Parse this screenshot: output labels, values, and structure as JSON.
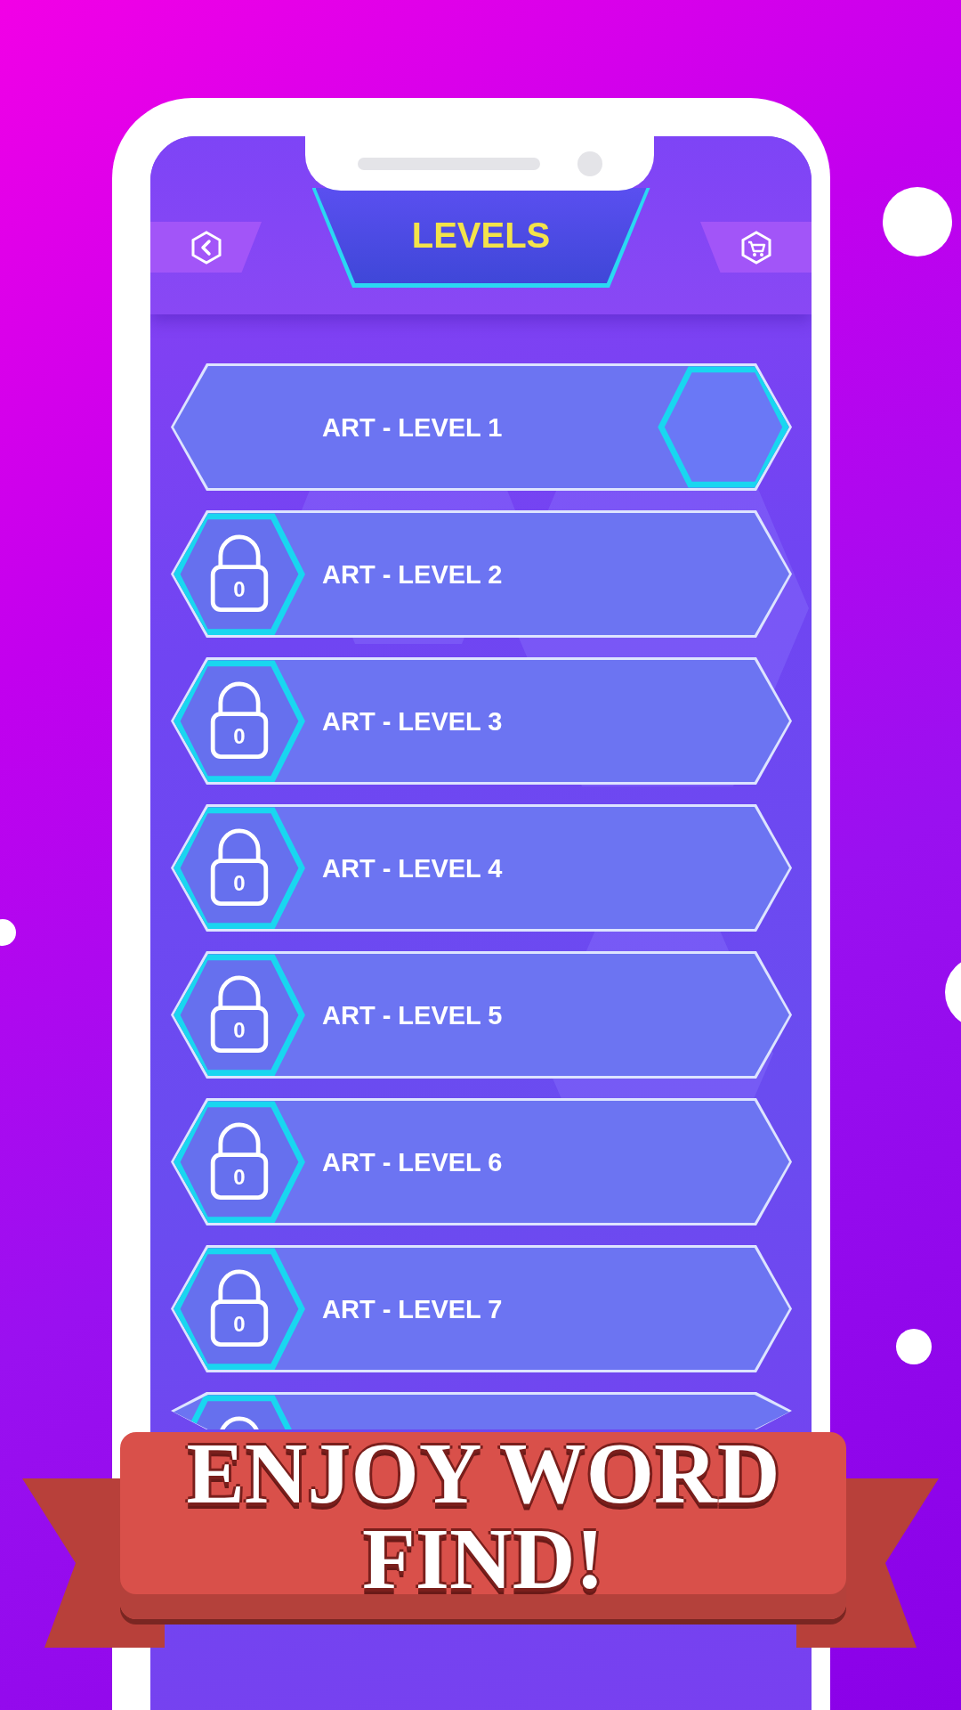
{
  "header": {
    "title": "LEVELS"
  },
  "levels": [
    {
      "label": "ART - LEVEL 1",
      "locked": false
    },
    {
      "label": "ART - LEVEL 2",
      "locked": true,
      "lock_count": "0"
    },
    {
      "label": "ART - LEVEL 3",
      "locked": true,
      "lock_count": "0"
    },
    {
      "label": "ART - LEVEL 4",
      "locked": true,
      "lock_count": "0"
    },
    {
      "label": "ART - LEVEL 5",
      "locked": true,
      "lock_count": "0"
    },
    {
      "label": "ART - LEVEL 6",
      "locked": true,
      "lock_count": "0"
    },
    {
      "label": "ART - LEVEL 7",
      "locked": true,
      "lock_count": "0"
    },
    {
      "locked": true
    }
  ],
  "banner": {
    "text": "ENJOY WORD FIND!"
  }
}
